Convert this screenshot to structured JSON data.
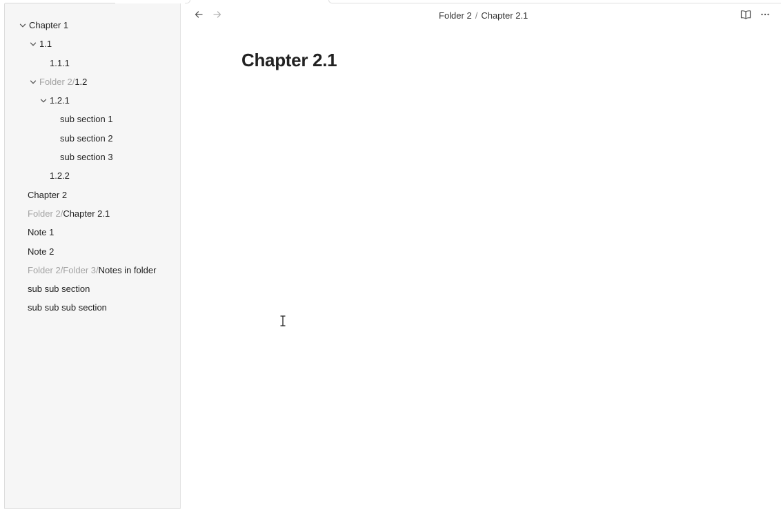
{
  "sidebar": {
    "items": [
      {
        "prefix": "",
        "label": "Chapter 1",
        "chevron": true
      },
      {
        "prefix": "",
        "label": "1.1",
        "chevron": true
      },
      {
        "prefix": "",
        "label": "1.1.1",
        "chevron": false
      },
      {
        "prefix": "Folder 2/",
        "label": "1.2",
        "chevron": true
      },
      {
        "prefix": "",
        "label": "1.2.1",
        "chevron": true
      },
      {
        "prefix": "",
        "label": "sub section 1",
        "chevron": false
      },
      {
        "prefix": "",
        "label": "sub section 2",
        "chevron": false
      },
      {
        "prefix": "",
        "label": "sub section 3",
        "chevron": false
      },
      {
        "prefix": "",
        "label": "1.2.2",
        "chevron": false
      },
      {
        "prefix": "",
        "label": "Chapter 2",
        "chevron": false
      },
      {
        "prefix": "Folder 2/",
        "label": "Chapter 2.1",
        "chevron": false
      },
      {
        "prefix": "",
        "label": "Note 1",
        "chevron": false
      },
      {
        "prefix": "",
        "label": "Note 2",
        "chevron": false
      },
      {
        "prefix": "Folder 2/Folder 3/",
        "label": "Notes in folder",
        "chevron": false
      },
      {
        "prefix": "",
        "label": "sub sub section",
        "chevron": false
      },
      {
        "prefix": "",
        "label": "sub sub sub section",
        "chevron": false
      }
    ]
  },
  "header": {
    "back_icon": "arrow-left-icon",
    "forward_icon": "arrow-right-icon",
    "breadcrumb_folder": "Folder 2",
    "breadcrumb_separator": "/",
    "breadcrumb_note": "Chapter 2.1",
    "reading_view_icon": "book-open-icon",
    "more_icon": "more-options-icon"
  },
  "main": {
    "title": "Chapter 2.1"
  },
  "colors": {
    "sidebar_bg": "#f6f6f6",
    "prefix_text": "#a3a3a3",
    "text": "#222222"
  }
}
